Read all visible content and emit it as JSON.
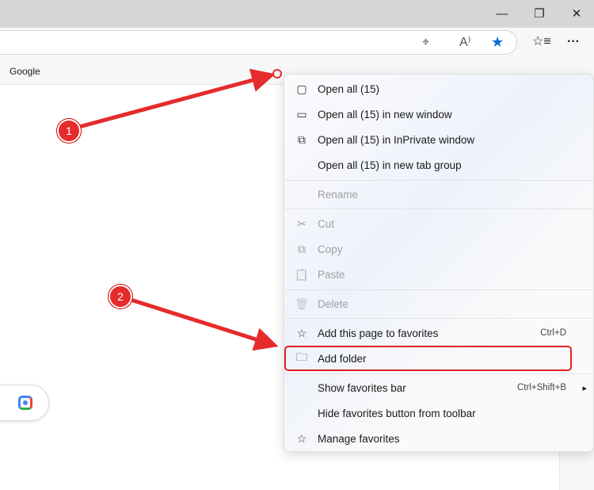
{
  "window": {
    "minimize": "—",
    "restore": "❐",
    "close": "✕"
  },
  "toolbar": {
    "location_icon": "location-icon",
    "read_aloud": "A⁾",
    "favorite_star": "★",
    "favorites": "☆≡",
    "more": "···"
  },
  "favorites_bar": {
    "items": [
      {
        "label": "Google"
      }
    ]
  },
  "menu": {
    "items": [
      {
        "label": "Open all (15)",
        "icon": "▢"
      },
      {
        "label": "Open all (15) in new window",
        "icon": "▭"
      },
      {
        "label": "Open all (15) in InPrivate window",
        "icon": "⧉"
      },
      {
        "label": "Open all (15) in new tab group",
        "icon": ""
      },
      {
        "label": "Rename",
        "disabled": true
      },
      {
        "label": "Cut",
        "icon": "✂",
        "disabled": true
      },
      {
        "label": "Copy",
        "icon": "⧉",
        "disabled": true
      },
      {
        "label": "Paste",
        "icon": "📋",
        "disabled": true
      },
      {
        "label": "Delete",
        "icon": "🗑",
        "disabled": true
      },
      {
        "label": "Add this page to favorites",
        "icon": "☆",
        "shortcut": "Ctrl+D"
      },
      {
        "label": "Add folder",
        "icon": "🗀"
      },
      {
        "label": "Show favorites bar",
        "shortcut": "Ctrl+Shift+B",
        "submenu": "▸"
      },
      {
        "label": "Hide favorites button from toolbar"
      },
      {
        "label": "Manage favorites",
        "icon": "☆"
      }
    ]
  },
  "annotations": {
    "step1": "1",
    "step2": "2"
  },
  "colors": {
    "accent": "#0a6ed1",
    "annotation": "#e52b2b"
  }
}
